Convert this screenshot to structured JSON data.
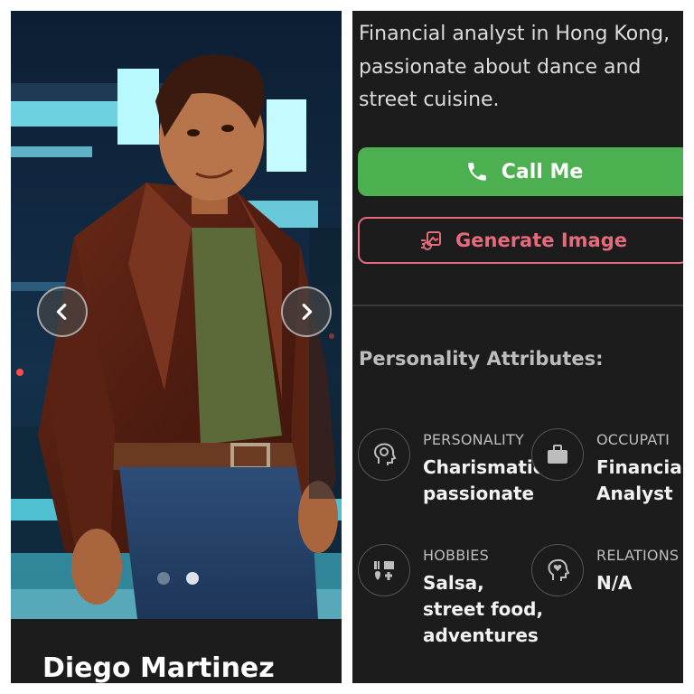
{
  "profile": {
    "name": "Diego Martinez",
    "bio": "Financial analyst in Hong Kong, passionate about dance and street cuisine."
  },
  "carousel": {
    "prev_icon": "chevron-left-icon",
    "next_icon": "chevron-right-icon",
    "slide_count": 2,
    "active_slide": 2
  },
  "actions": {
    "call_label": "Call Me",
    "call_icon": "phone-icon",
    "generate_label": "Generate Image",
    "generate_icon": "image-sparkle-icon"
  },
  "attributes": {
    "section_title": "Personality Attributes:",
    "items": [
      {
        "label": "PERSONALITY",
        "value": [
          "Charismatic,",
          "passionate"
        ],
        "icon": "brain-gear-icon"
      },
      {
        "label": "OCCUPATI",
        "value": [
          "Financia",
          "Analyst"
        ],
        "icon": "briefcase-icon"
      },
      {
        "label": "HOBBIES",
        "value": [
          "Salsa,",
          "street food,",
          "adventures"
        ],
        "icon": "hobbies-icon"
      },
      {
        "label": "RELATIONS",
        "value": [
          "N/A"
        ],
        "icon": "heart-head-icon"
      }
    ]
  },
  "colors": {
    "panel_bg": "#1c1c1c",
    "call_green": "#4caf50",
    "generate_pink": "#e46b7b",
    "text_muted": "#bdbdbd"
  }
}
